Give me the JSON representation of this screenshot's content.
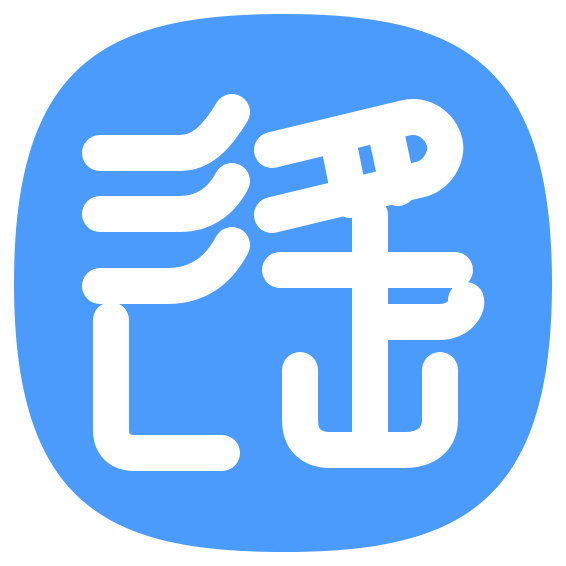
{
  "app_icon": {
    "glyph": "遥",
    "background_color": "#4A9BFB",
    "glyph_color": "#FFFFFF",
    "shape": "squircle"
  }
}
